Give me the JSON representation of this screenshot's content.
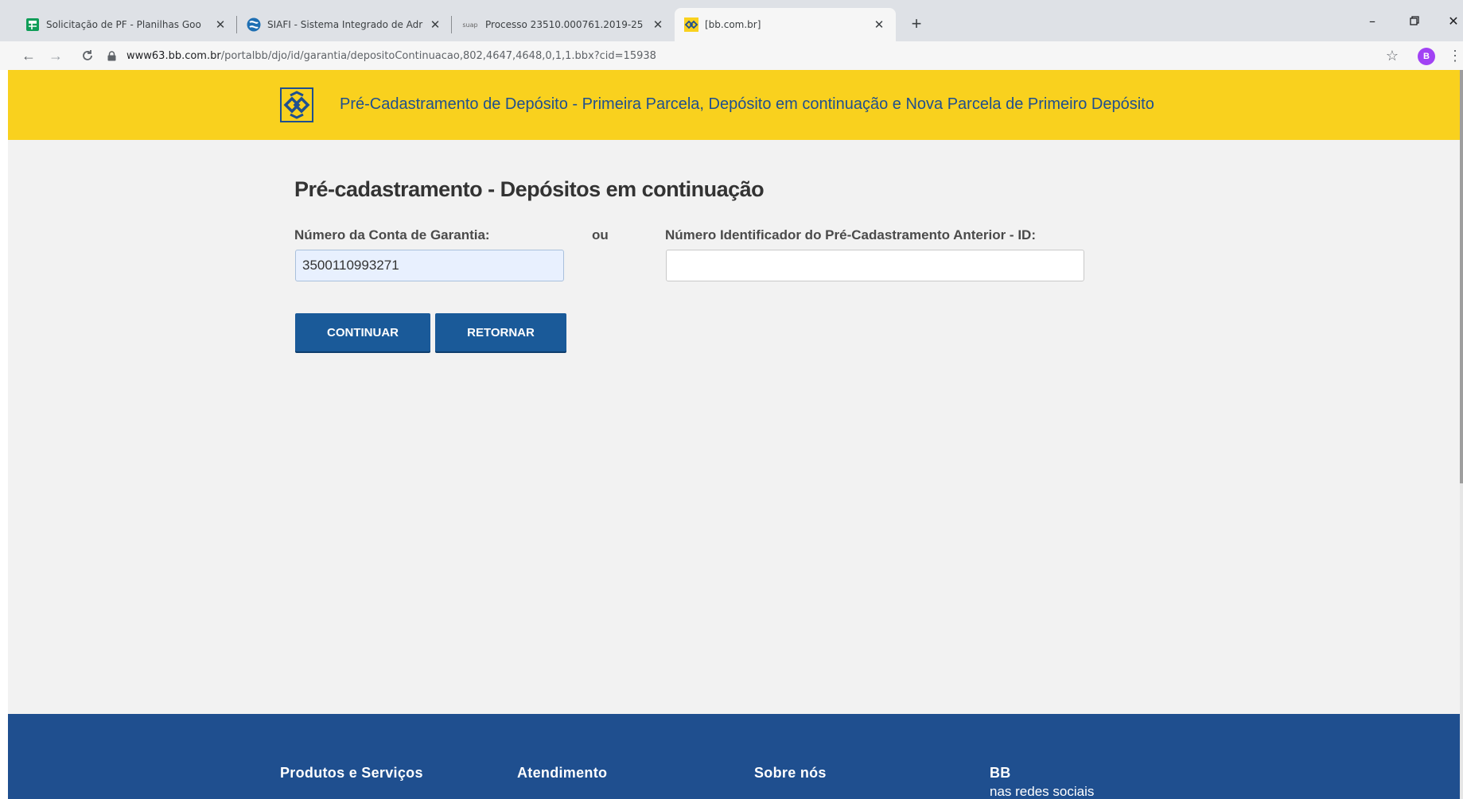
{
  "browser": {
    "tabs": [
      {
        "title": "Solicitação de PF - Planilhas Goo",
        "icon": "google-sheets-icon",
        "active": false
      },
      {
        "title": "SIAFI - Sistema Integrado de Adr",
        "icon": "siafi-icon",
        "active": false
      },
      {
        "title": "Processo 23510.000761.2019-25",
        "icon": "suap-icon",
        "favicon_text": "suap",
        "active": false
      },
      {
        "title": "[bb.com.br]",
        "icon": "bb-icon",
        "active": true
      }
    ],
    "new_tab": "+",
    "url_host": "www63.bb.com.br",
    "url_path": "/portalbb/djo/id/garantia/depositoContinuacao,802,4647,4648,0,1,1.bbx?cid=15938",
    "profile_initial": "B",
    "profile_color": "#a142f4"
  },
  "banner": {
    "title": "Pré-Cadastramento de Depósito - Primeira Parcela, Depósito em continuação e Nova Parcela de Primeiro Depósito",
    "color": "#f9d11e"
  },
  "form": {
    "title": "Pré-cadastramento - Depósitos em continuação",
    "account_label": "Número da Conta de Garantia:",
    "or_label": "ou",
    "id_label": "Número Identificador do Pré-Cadastramento Anterior - ID:",
    "account_value": "3500110993271",
    "id_value": "",
    "continue_label": "CONTINUAR",
    "return_label": "RETORNAR",
    "button_color": "#1a5a99"
  },
  "footer": {
    "columns": [
      "Produtos e Serviços",
      "Atendimento",
      "Sobre nós",
      "BB"
    ],
    "bb_subtitle": "nas redes sociais",
    "color": "#1f4f8f"
  }
}
